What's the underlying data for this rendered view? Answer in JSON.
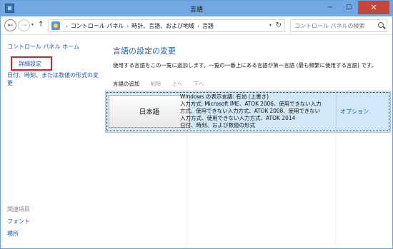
{
  "window": {
    "title": "言語",
    "minimize": "─",
    "maximize": "☐",
    "close": "✕"
  },
  "address": {
    "back": "←",
    "forward": "→",
    "dropdown": "▾",
    "up": "↑",
    "crumbs": [
      "コントロール パネル",
      "時計、言語、および地域",
      "言語"
    ],
    "separator": "›",
    "refresh": "↻",
    "search_placeholder": "コントロール パネルの検索"
  },
  "sidebar": {
    "home": "コントロール パネル ホーム",
    "advanced": "詳細設定",
    "date_time": "日付、時刻、または数値の形式の変更",
    "related_heading": "関連項目",
    "fonts": "フォント",
    "location": "場所"
  },
  "main": {
    "title": "言語の設定の変更",
    "description": "使用する言語をこの一覧に追加します。一覧の一番上にある言語が第一言語 (最も頻繁に使用する言語) です。",
    "toolbar": {
      "add": "言語の追加",
      "remove": "削除",
      "up": "上へ",
      "down": "下へ"
    },
    "languages": [
      {
        "name": "日本語",
        "info_lines": [
          "Windows の表示言語: 有効 (上書き)",
          "入力方式: Microsoft IME、ATOK 2006、使用できない入力",
          "方式、使用できない入力方式、ATOK 2008、使用できない",
          "入力方式、使用できない入力方式、ATOK 2014",
          "日付、時刻、および数値の形式"
        ],
        "options": "オプション"
      }
    ]
  },
  "colors": {
    "titlebar": "#6fa8e2",
    "link": "#1e55a8",
    "highlight_border": "#e02020",
    "selected_row": "#d2e8f8"
  }
}
